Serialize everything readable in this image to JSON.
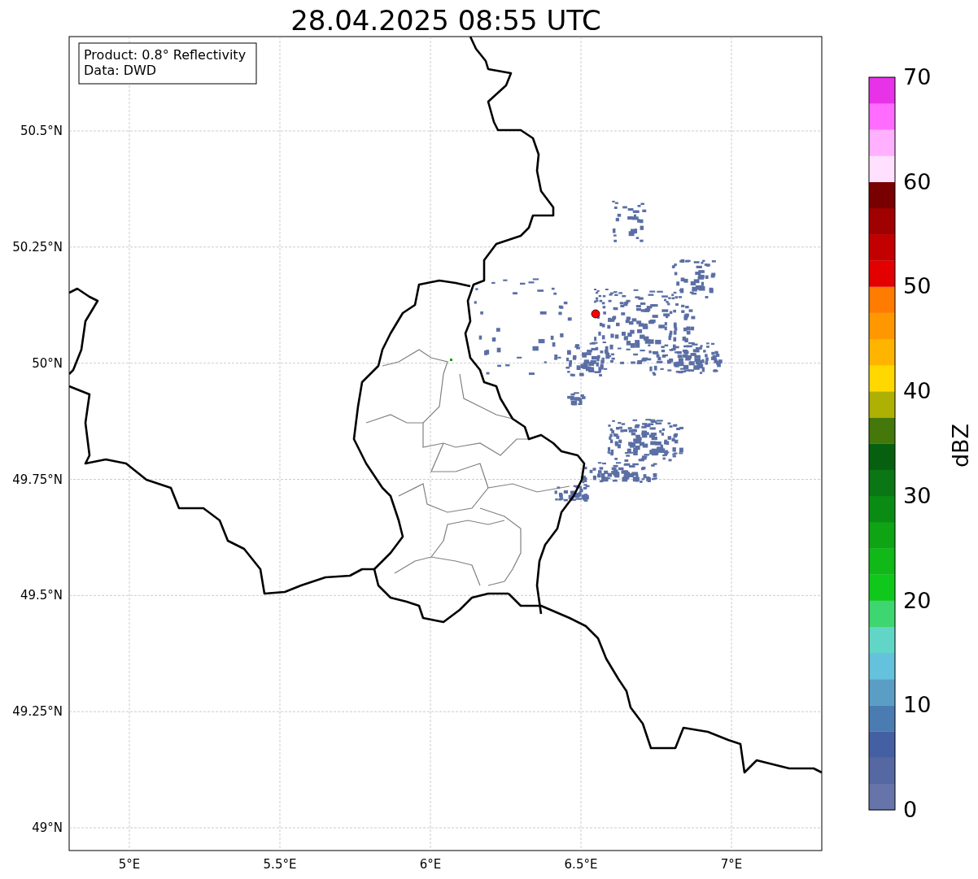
{
  "title": "28.04.2025 08:55 UTC",
  "info_box": {
    "lines": [
      "Product: 0.8° Reflectivity",
      "Data: DWD"
    ]
  },
  "map": {
    "xticks": [
      "5°E",
      "5.5°E",
      "6°E",
      "6.5°E",
      "7°E"
    ],
    "yticks": [
      "50.5°N",
      "50.25°N",
      "50°N",
      "49.75°N",
      "49.5°N",
      "49.25°N",
      "49°N"
    ]
  },
  "colorbar": {
    "label": "dBZ",
    "ticks": [
      "70",
      "60",
      "50",
      "40",
      "30",
      "20",
      "10",
      "0"
    ],
    "segments": [
      {
        "color": "#6674a9"
      },
      {
        "color": "#5568a2"
      },
      {
        "color": "#4460a2"
      },
      {
        "color": "#4a7cb2"
      },
      {
        "color": "#5a9ec6"
      },
      {
        "color": "#64c2dc"
      },
      {
        "color": "#62d6c6"
      },
      {
        "color": "#3ed670"
      },
      {
        "color": "#10c81c"
      },
      {
        "color": "#10b818"
      },
      {
        "color": "#0ea414"
      },
      {
        "color": "#0a8c14"
      },
      {
        "color": "#0a7614"
      },
      {
        "color": "#066010"
      },
      {
        "color": "#44780a"
      },
      {
        "color": "#aeb004"
      },
      {
        "color": "#ffd800"
      },
      {
        "color": "#ffb400"
      },
      {
        "color": "#ff9800"
      },
      {
        "color": "#ff7c00"
      },
      {
        "color": "#e20000"
      },
      {
        "color": "#c20000"
      },
      {
        "color": "#a00000"
      },
      {
        "color": "#780000"
      },
      {
        "color": "#ffe0ff"
      },
      {
        "color": "#ffb0ff"
      },
      {
        "color": "#ff6cff"
      },
      {
        "color": "#e832e8"
      }
    ]
  }
}
